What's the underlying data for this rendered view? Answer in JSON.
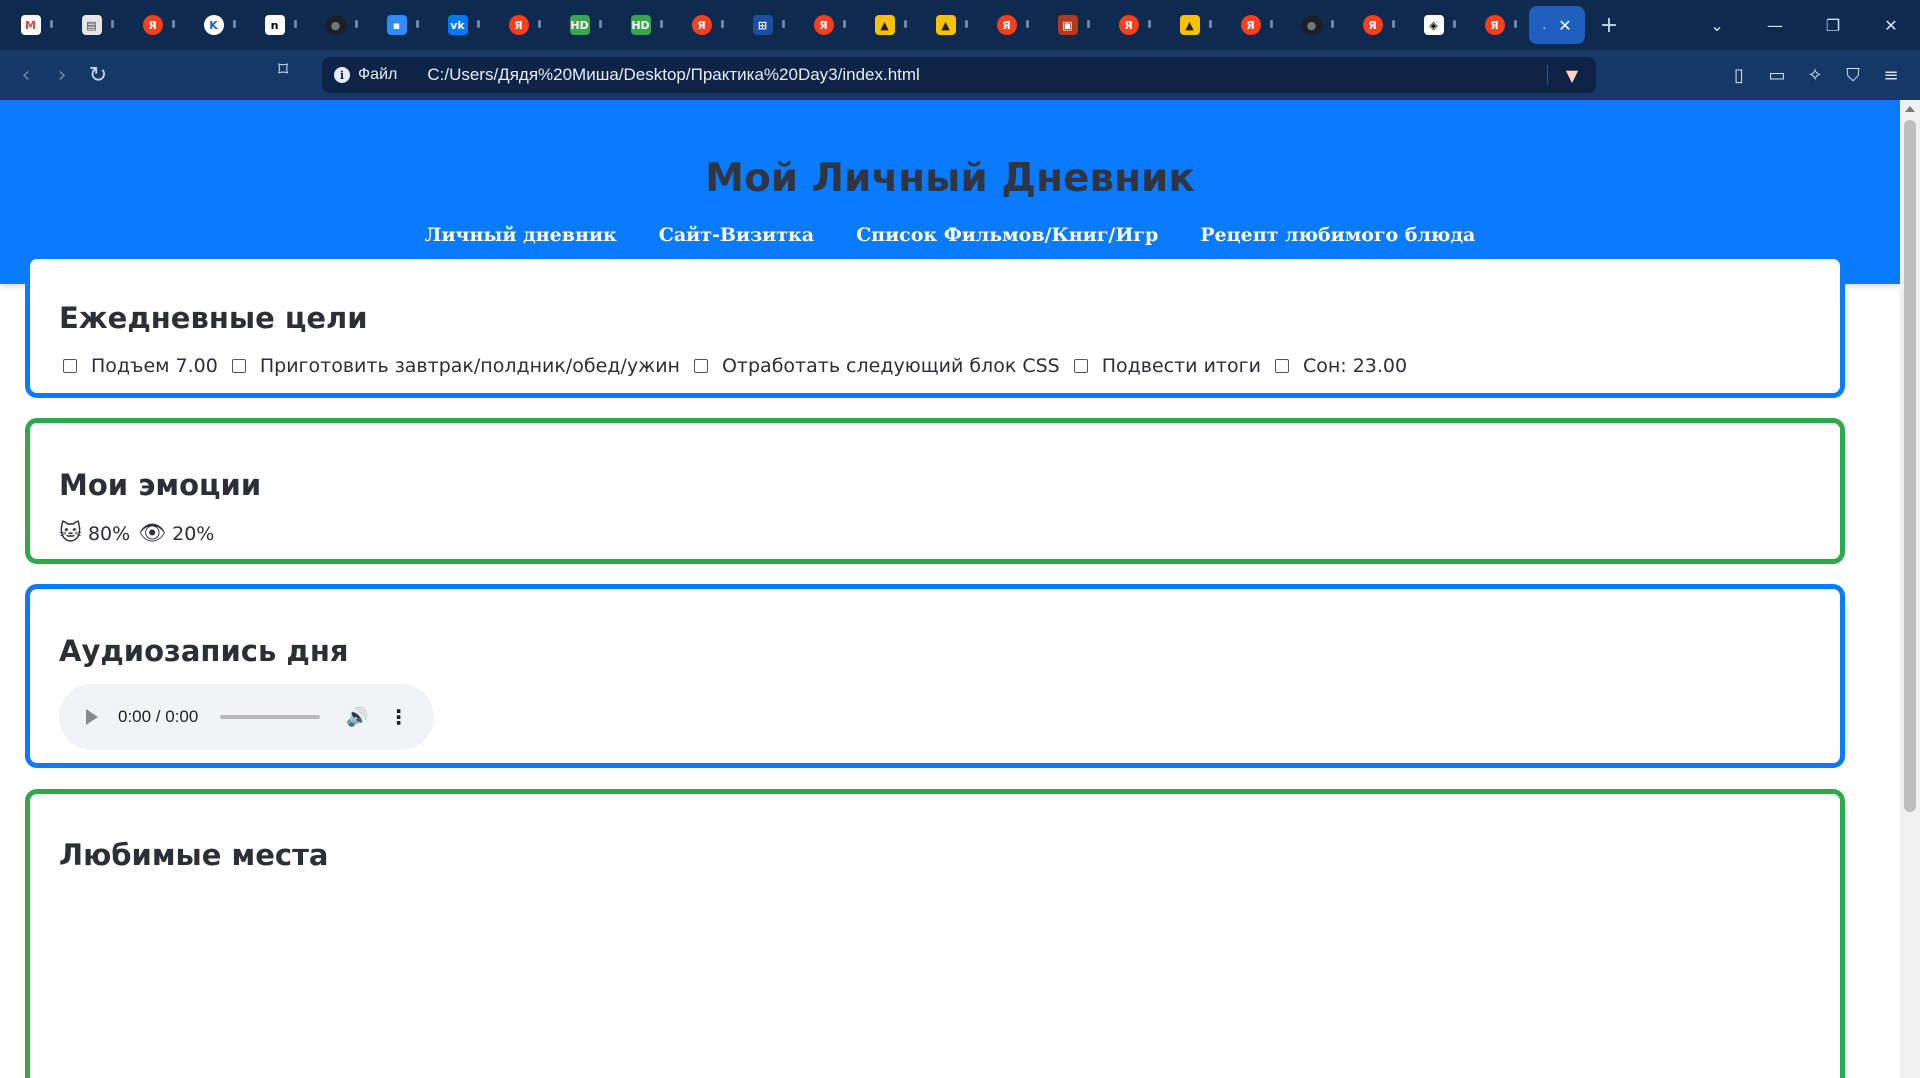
{
  "browser": {
    "tabs": [
      {
        "icon": "gmail-icon",
        "glyph": "M",
        "color": "#ffffff",
        "text_color": "#ea4335"
      },
      {
        "icon": "notepad-icon",
        "glyph": "▤",
        "color": "#e6e6e6",
        "text_color": "#444444"
      },
      {
        "icon": "yandex-icon",
        "glyph": "Я",
        "color": "#fc3f1d",
        "text_color": "#ffffff"
      },
      {
        "icon": "wiki-icon",
        "glyph": "K",
        "color": "#ffffff",
        "text_color": "#1f5fbf"
      },
      {
        "icon": "notion-icon",
        "glyph": "n",
        "color": "#ffffff",
        "text_color": "#000000"
      },
      {
        "icon": "github-icon",
        "glyph": "●",
        "color": "#1b1f24",
        "text_color": "#6e7681"
      },
      {
        "icon": "chat-icon",
        "glyph": "▪",
        "color": "#2f8cff",
        "text_color": "#ffffff"
      },
      {
        "icon": "vk-icon",
        "glyph": "vk",
        "color": "#0077ff",
        "text_color": "#ffffff"
      },
      {
        "icon": "yandex-icon",
        "glyph": "Я",
        "color": "#fc3f1d",
        "text_color": "#ffffff"
      },
      {
        "icon": "hd-icon",
        "glyph": "HD",
        "color": "#3aa64b",
        "text_color": "#ffffff"
      },
      {
        "icon": "hd-icon",
        "glyph": "HD",
        "color": "#3aa64b",
        "text_color": "#ffffff"
      },
      {
        "icon": "yandex-icon",
        "glyph": "Я",
        "color": "#fc3f1d",
        "text_color": "#ffffff"
      },
      {
        "icon": "grid-icon",
        "glyph": "⊞",
        "color": "#1a4fa0",
        "text_color": "#ffffff"
      },
      {
        "icon": "yandex-icon",
        "glyph": "Я",
        "color": "#fc3f1d",
        "text_color": "#ffffff"
      },
      {
        "icon": "image-icon",
        "glyph": "▲",
        "color": "#f6c200",
        "text_color": "#222222"
      },
      {
        "icon": "image-icon",
        "glyph": "▲",
        "color": "#f6c200",
        "text_color": "#222222"
      },
      {
        "icon": "yandex-icon",
        "glyph": "Я",
        "color": "#fc3f1d",
        "text_color": "#ffffff"
      },
      {
        "icon": "picture-icon",
        "glyph": "▣",
        "color": "#b33a1d",
        "text_color": "#ffffff"
      },
      {
        "icon": "yandex-icon",
        "glyph": "Я",
        "color": "#fc3f1d",
        "text_color": "#ffffff"
      },
      {
        "icon": "image-icon",
        "glyph": "▲",
        "color": "#f6c200",
        "text_color": "#222222"
      },
      {
        "icon": "yandex-icon",
        "glyph": "Я",
        "color": "#fc3f1d",
        "text_color": "#ffffff"
      },
      {
        "icon": "github-icon",
        "glyph": "●",
        "color": "#1b1f24",
        "text_color": "#6e7681"
      },
      {
        "icon": "yandex-icon",
        "glyph": "Я",
        "color": "#fc3f1d",
        "text_color": "#ffffff"
      },
      {
        "icon": "codepen-icon",
        "glyph": "◈",
        "color": "#ffffff",
        "text_color": "#000000"
      },
      {
        "icon": "yandex-icon",
        "glyph": "Я",
        "color": "#fc3f1d",
        "text_color": "#ffffff"
      }
    ],
    "active_tab": {
      "title": ".",
      "close": "✕"
    },
    "new_tab": "+",
    "window_controls": {
      "list": "⌄",
      "minimize": "—",
      "restore": "❐",
      "close": "✕"
    },
    "nav": {
      "back": "‹",
      "forward": "›",
      "reload": "↻",
      "bookmark": "⌑"
    },
    "address": {
      "info_glyph": "i",
      "scheme_label": "Файл",
      "url": "C:/Users/Дядя%20Миша/Desktop/Практика%20Day3/index.html",
      "shield_glyph": "▼"
    },
    "right_icons": [
      "sidebar-icon",
      "wallet-icon",
      "leo-icon",
      "vpn-icon",
      "menu-icon"
    ],
    "right_glyphs": [
      "▯",
      "▭",
      "✧",
      "⛉",
      "≡"
    ]
  },
  "page": {
    "colors": {
      "header_bg": "#0a7bff",
      "card_blue": "#0a7bff",
      "card_green": "#2ea84a"
    },
    "title": "Мой Личный Дневник",
    "nav_links": [
      "Личный дневник",
      "Сайт-Визитка",
      "Список Фильмов/Книг/Игр",
      "Рецепт любимого блюда"
    ],
    "goals": {
      "heading": "Ежедневные цели",
      "items": [
        "Подъем 7.00",
        "Приготовить завтрак/полдник/обед/ужин",
        "Отработать следующий блок CSS",
        "Подвести итоги",
        "Сон: 23.00"
      ]
    },
    "emotions": {
      "heading": "Мои эмоции",
      "items": [
        {
          "icon": "cat-face-icon",
          "glyph": "🐱",
          "value": "80%"
        },
        {
          "icon": "eye-icon",
          "glyph": "👁",
          "value": "20%"
        }
      ]
    },
    "audio": {
      "heading": "Аудиозапись дня",
      "time": "0:00 / 0:00",
      "progress": 0
    },
    "places": {
      "heading": "Любимые места"
    }
  }
}
